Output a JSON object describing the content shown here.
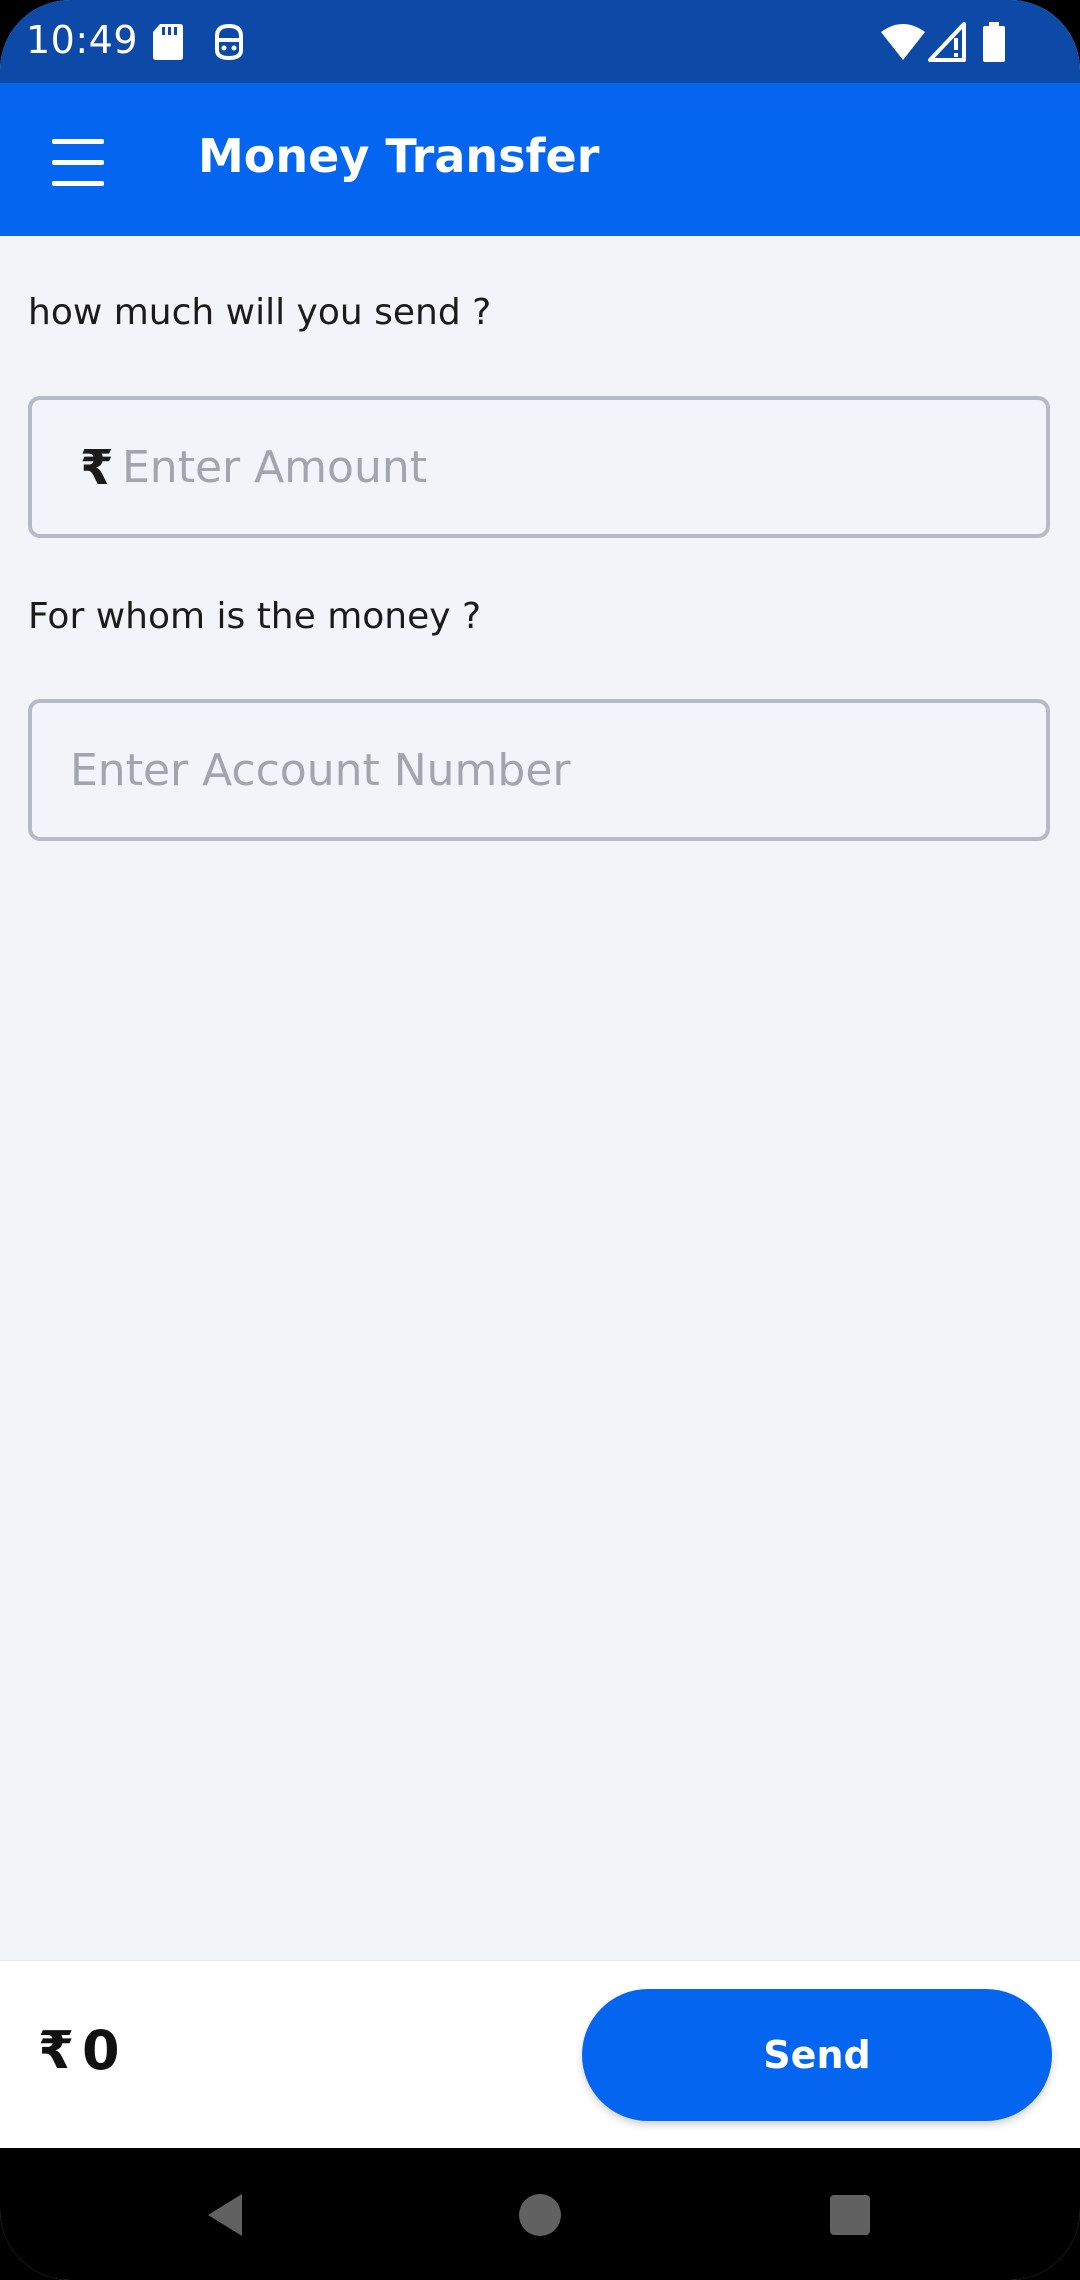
{
  "status_bar": {
    "time": "10:49",
    "icons": [
      "sd-card-icon",
      "notification-icon",
      "wifi-icon",
      "signal-icon",
      "battery-icon"
    ]
  },
  "app_bar": {
    "title": "Money Transfer",
    "menu_icon": "hamburger-menu-icon",
    "background_color": "#0466f0"
  },
  "form": {
    "amount_label": "how much will you send ?",
    "amount_prefix": "₹",
    "amount_placeholder": "Enter Amount",
    "amount_value": "",
    "account_label": "For whom is the money ?",
    "account_placeholder": "Enter Account Number",
    "account_value": ""
  },
  "footer": {
    "total_currency": "₹",
    "total_value": "0",
    "send_label": "Send",
    "accent_color": "#0466f0"
  },
  "nav": {
    "icons": [
      "back-icon",
      "home-icon",
      "recents-icon"
    ]
  }
}
